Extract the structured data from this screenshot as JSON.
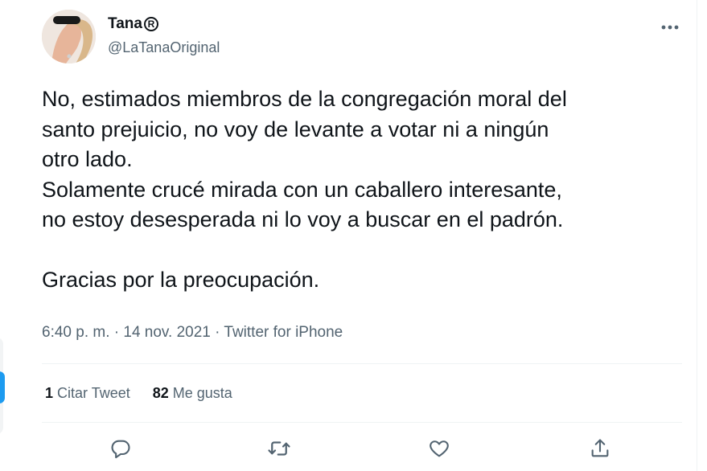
{
  "author": {
    "display_name": "Tana",
    "registered_mark": "R",
    "handle": "@LaTanaOriginal"
  },
  "tweet": {
    "text": "No, estimados miembros de la congregación moral del\nsanto prejuicio, no voy de levante a votar ni a ningún\notro lado.\nSolamente crucé mirada con un caballero interesante,\nno estoy desesperada ni lo voy a buscar en el padrón.\n\nGracias por la preocupación.",
    "time": "6:40 p. m.",
    "date": "14 nov. 2021",
    "separator": "·",
    "source": "Twitter for iPhone"
  },
  "stats": {
    "quotes_count": "1",
    "quotes_label": "Citar Tweet",
    "likes_count": "82",
    "likes_label": "Me gusta"
  },
  "icons": {
    "more": "more-horizontal-icon",
    "reply": "reply-icon",
    "retweet": "retweet-icon",
    "like": "heart-icon",
    "share": "share-icon"
  },
  "colors": {
    "text": "#0f1419",
    "secondary": "#536471",
    "divider": "#eff3f4",
    "accent": "#1d9bf0"
  }
}
